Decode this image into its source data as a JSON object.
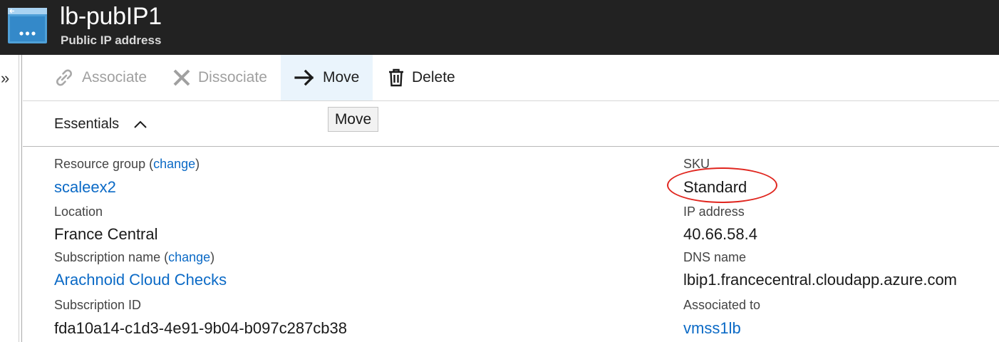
{
  "header": {
    "title": "lb-pubIP1",
    "subtitle": "Public IP address"
  },
  "nav": {
    "expand_glyph": "»"
  },
  "toolbar": {
    "associate_label": "Associate",
    "dissociate_label": "Dissociate",
    "move_label": "Move",
    "delete_label": "Delete",
    "tooltip": "Move"
  },
  "essentials": {
    "label": "Essentials"
  },
  "fields_left": {
    "resource_group_label": "Resource group",
    "resource_group_change": "change",
    "resource_group_value": "scaleex2",
    "location_label": "Location",
    "location_value": "France Central",
    "subscription_label": "Subscription name",
    "subscription_change": "change",
    "subscription_value": "Arachnoid Cloud Checks",
    "subscription_id_label": "Subscription ID",
    "subscription_id_value": "fda10a14-c1d3-4e91-9b04-b097c287cb38"
  },
  "fields_right": {
    "sku_label": "SKU",
    "sku_value": "Standard",
    "ip_label": "IP address",
    "ip_value": "40.66.58.4",
    "dns_label": "DNS name",
    "dns_value": "lbip1.francecentral.cloudapp.azure.com",
    "associated_label": "Associated to",
    "associated_value": "vmss1lb"
  },
  "colors": {
    "header_bg": "#222222",
    "link": "#0b6ac6",
    "annotation_ring": "#e0261f",
    "hover_bg": "#eaf4fc"
  },
  "icons": {
    "resource": "public-ip-icon",
    "associate": "link-icon",
    "dissociate": "close-icon",
    "move": "arrow-right-icon",
    "delete": "trash-icon",
    "essentials_toggle": "chevron-up-icon"
  }
}
